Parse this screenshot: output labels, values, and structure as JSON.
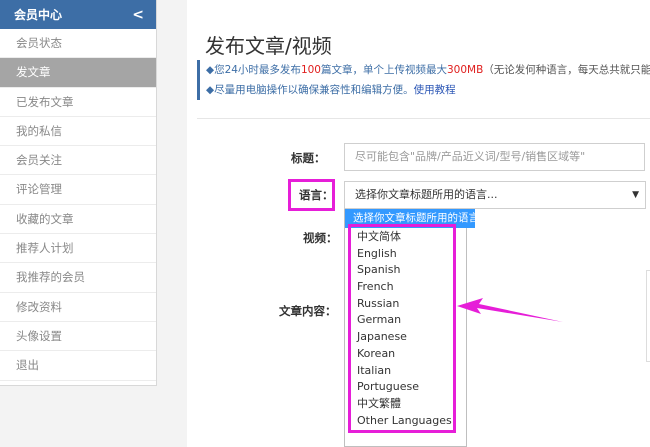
{
  "sidebar": {
    "title": "会员中心",
    "collapse_glyph": "<",
    "items": [
      {
        "label": "会员状态",
        "active": false
      },
      {
        "label": "发文章",
        "active": true
      },
      {
        "label": "已发布文章",
        "active": false
      },
      {
        "label": "我的私信",
        "active": false
      },
      {
        "label": "会员关注",
        "active": false
      },
      {
        "label": "评论管理",
        "active": false
      },
      {
        "label": "收藏的文章",
        "active": false
      },
      {
        "label": "推荐人计划",
        "active": false
      },
      {
        "label": "我推荐的会员",
        "active": false
      },
      {
        "label": "修改资料",
        "active": false
      },
      {
        "label": "头像设置",
        "active": false
      },
      {
        "label": "退出",
        "active": false
      }
    ]
  },
  "main": {
    "title": "发布文章/视频",
    "notice1": {
      "prefix": "◆您24小时最多发布",
      "count": "100",
      "mid": "篇文章，单个上传视频最大",
      "size": "300MB",
      "suffix": "（无论发何种语言，每天总共就只能发"
    },
    "notice2": {
      "text": "◆尽量用电脑操作以确保兼容性和编辑方便。",
      "link": "使用教程"
    }
  },
  "form": {
    "title_label": "标题：",
    "title_placeholder": "尽可能包含\"品牌/产品近义词/型号/销售区域等\"",
    "language_label": "语言：",
    "language_selected": "选择你文章标题所用的语言...",
    "video_label": "视频：",
    "content_label": "文章内容：",
    "language_options": [
      "中文简体",
      "English",
      "Spanish",
      "French",
      "Russian",
      "German",
      "Japanese",
      "Korean",
      "Italian",
      "Portuguese",
      "中文繁體",
      "Other Languages"
    ]
  },
  "colors": {
    "accent": "#3d6ea6",
    "highlight": "#e61ed8",
    "option_selected": "#3399ff",
    "red": "#e0201f"
  }
}
